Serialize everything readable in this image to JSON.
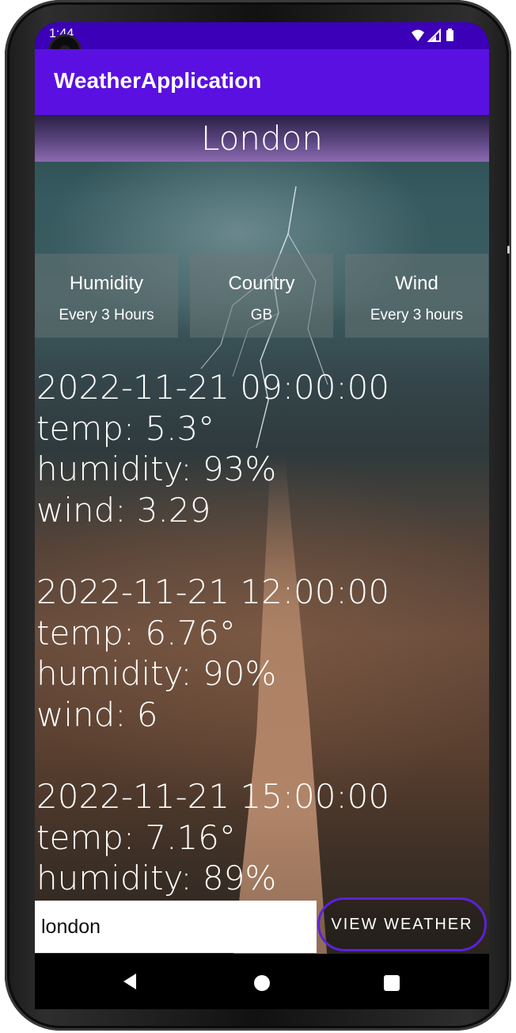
{
  "status": {
    "time": "1:44"
  },
  "app_bar": {
    "title": "WeatherApplication"
  },
  "header": {
    "city": "London"
  },
  "cards": [
    {
      "title": "Humidity",
      "subtitle": "Every 3 Hours"
    },
    {
      "title": "Country",
      "subtitle": "GB"
    },
    {
      "title": "Wind",
      "subtitle": "Every 3 hours"
    }
  ],
  "forecast": [
    {
      "datetime": "2022-11-21 09:00:00",
      "temp": "temp: 5.3°",
      "humidity": "humidity: 93%",
      "wind": "wind: 3.29"
    },
    {
      "datetime": "2022-11-21 12:00:00",
      "temp": "temp: 6.76°",
      "humidity": "humidity: 90%",
      "wind": "wind: 6"
    },
    {
      "datetime": "2022-11-21 15:00:00",
      "temp": "temp: 7.16°",
      "humidity": "humidity: 89%"
    }
  ],
  "search": {
    "value": "london",
    "button_label": "VIEW WEATHER"
  },
  "colors": {
    "status_bar": "#3c00b8",
    "app_bar": "#5a10e0",
    "button_border": "#5a22d8"
  },
  "icons": [
    "wifi-icon",
    "cellular-signal-icon",
    "battery-icon",
    "camera-cutout-icon",
    "back-icon",
    "home-icon",
    "recents-icon"
  ]
}
